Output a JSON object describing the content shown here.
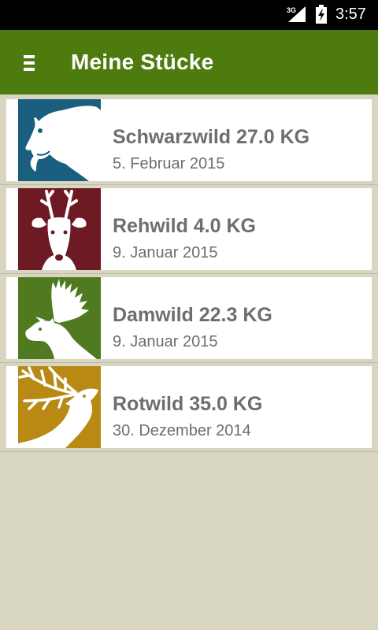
{
  "status": {
    "network": "3G",
    "time": "3:57"
  },
  "appbar": {
    "title": "Meine Stücke"
  },
  "items": [
    {
      "name": "Schwarzwild 27.0 KG",
      "date": "5. Februar 2015",
      "icon": "boar-icon",
      "color": "#1a5f80"
    },
    {
      "name": "Rehwild 4.0 KG",
      "date": "9. Januar 2015",
      "icon": "roe-deer-icon",
      "color": "#6e1a24"
    },
    {
      "name": "Damwild 22.3 KG",
      "date": "9. Januar 2015",
      "icon": "fallow-deer-icon",
      "color": "#507a20"
    },
    {
      "name": "Rotwild 35.0 KG",
      "date": "30. Dezember 2014",
      "icon": "red-deer-icon",
      "color": "#b88a14"
    }
  ],
  "colors": {
    "appbar": "#4e7b0d",
    "background": "#d8d5c1",
    "text": "#6e6e6e"
  }
}
